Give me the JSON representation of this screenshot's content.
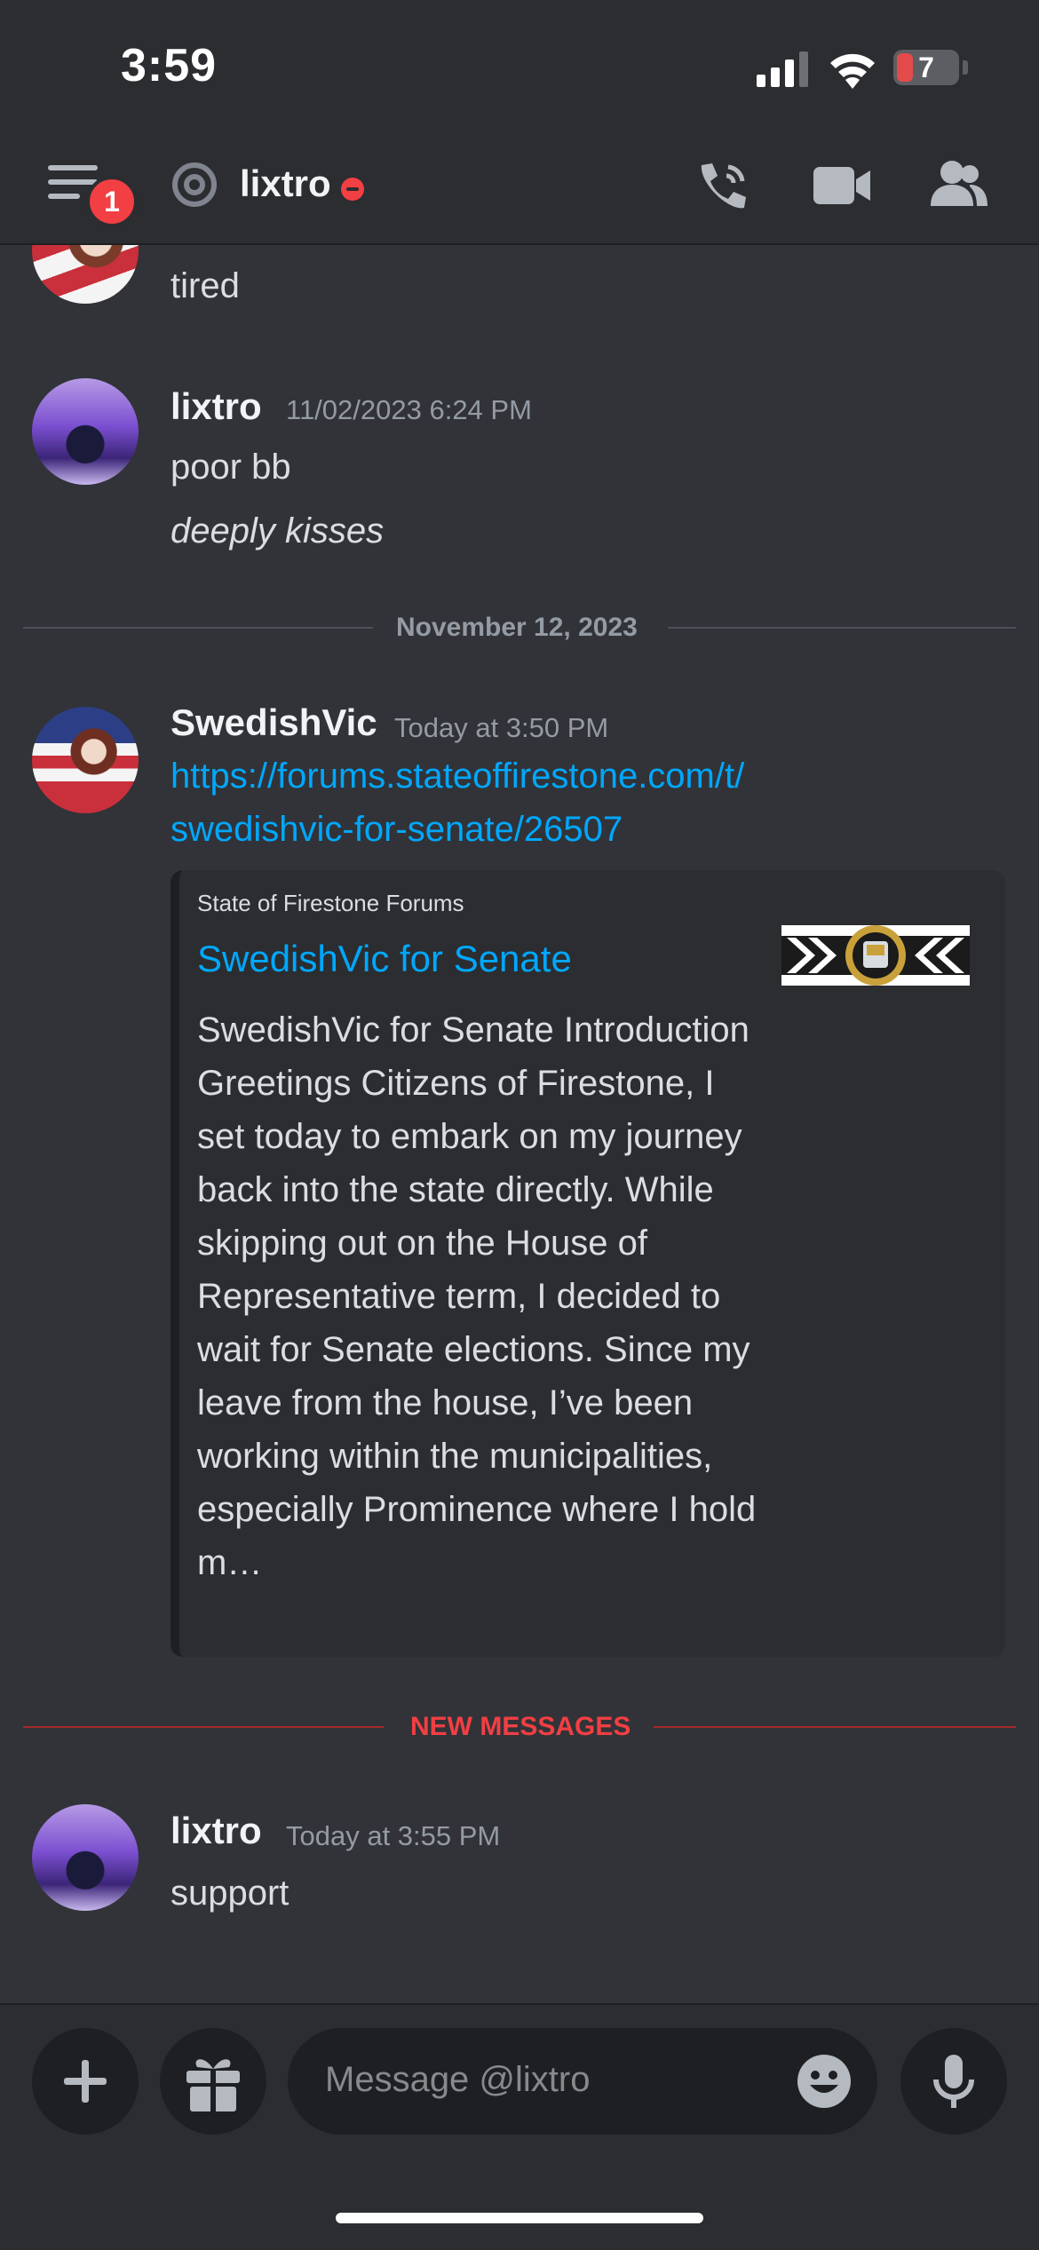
{
  "status": {
    "time": "3:59",
    "battery": "7"
  },
  "header": {
    "badge": "1",
    "username": "lixtro"
  },
  "messages": [
    {
      "text": "tired"
    },
    {
      "author": "lixtro",
      "time": "11/02/2023 6:24 PM",
      "lines": [
        "poor bb",
        "deeply kisses"
      ]
    },
    {
      "author": "SwedishVic",
      "time": "Today at 3:50 PM",
      "link": "https://forums.stateoffirestone.com/t/swedishvic-for-senate/26507",
      "link_line1": "https://forums.stateoffirestone.com/t/",
      "link_line2": "swedishvic-for-senate/26507"
    },
    {
      "author": "lixtro",
      "time": "Today at 3:55 PM",
      "text": "support"
    }
  ],
  "date_divider": "November 12, 2023",
  "new_divider": "NEW MESSAGES",
  "embed": {
    "provider": "State of Firestone Forums",
    "title": "SwedishVic for Senate",
    "description": "SwedishVic for Senate Introduction  Greetings Citizens of Firestone,  I set today to embark on my journey back into the state directly. While skipping out on the House of Representative term, I decided to wait for Senate elections. Since my leave from the house, I’ve been working within the municipalities, especially Prominence where I hold m…"
  },
  "input": {
    "placeholder": "Message @lixtro"
  },
  "colors": {
    "background": "#313338",
    "header": "#2b2d31",
    "link": "#00a8fc",
    "danger": "#f23f43"
  }
}
